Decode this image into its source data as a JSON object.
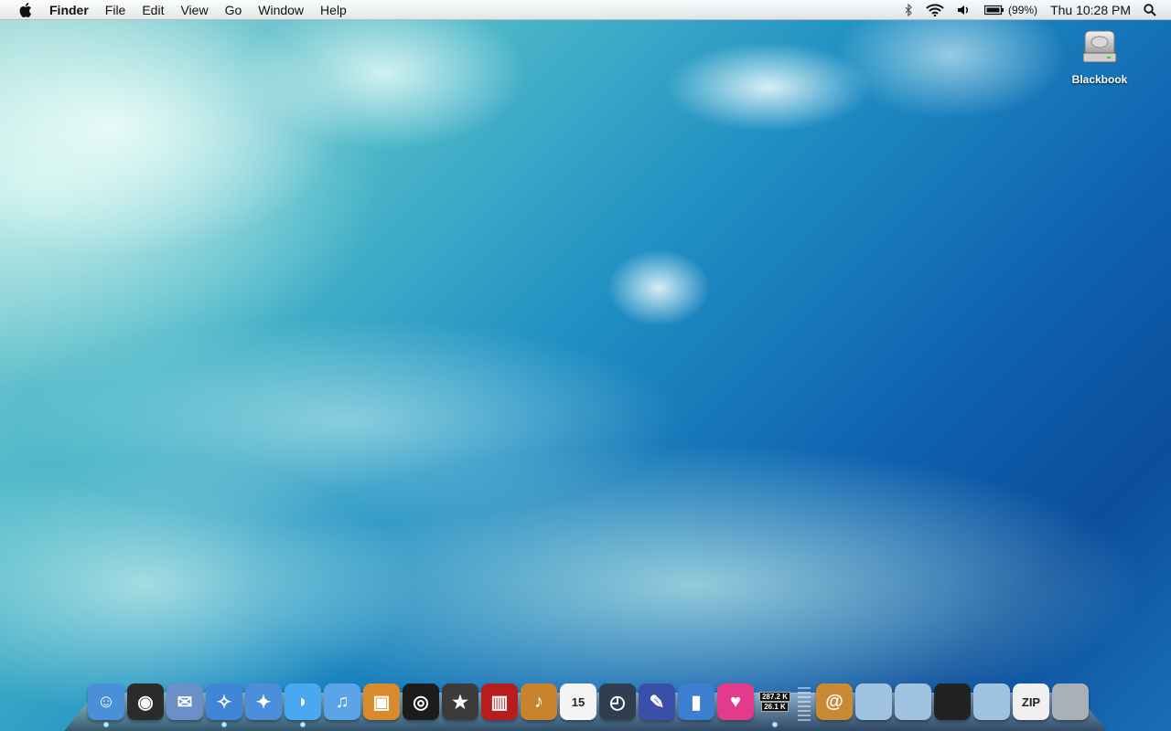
{
  "menubar": {
    "app_name": "Finder",
    "items": [
      "File",
      "Edit",
      "View",
      "Go",
      "Window",
      "Help"
    ],
    "status": {
      "battery_percent": "(99%)",
      "clock": "Thu 10:28 PM",
      "icons": [
        "bluetooth-icon",
        "wifi-icon",
        "volume-icon",
        "battery-icon",
        "spotlight-icon"
      ]
    }
  },
  "desktop": {
    "disk_label": "Blackbook"
  },
  "dock": {
    "apps": [
      {
        "name": "finder",
        "glyph": "☺",
        "color": "#4a90d9",
        "running": true
      },
      {
        "name": "dashboard",
        "glyph": "◉",
        "color": "#2b2b2b",
        "running": false
      },
      {
        "name": "mail",
        "glyph": "✉",
        "color": "#6a8fc9",
        "running": false
      },
      {
        "name": "safari",
        "glyph": "✧",
        "color": "#3f87d6",
        "running": true
      },
      {
        "name": "network",
        "glyph": "✦",
        "color": "#4c8ed9",
        "running": false
      },
      {
        "name": "ichat",
        "glyph": "◗",
        "color": "#4aa8f0",
        "running": true
      },
      {
        "name": "itunes",
        "glyph": "♫",
        "color": "#5aa4e8",
        "running": false
      },
      {
        "name": "iphoto",
        "glyph": "▣",
        "color": "#d88a2c",
        "running": false
      },
      {
        "name": "photo-booth",
        "glyph": "◎",
        "color": "#1c1c1c",
        "running": false
      },
      {
        "name": "imovie",
        "glyph": "★",
        "color": "#3b3b3b",
        "running": false
      },
      {
        "name": "front-row",
        "glyph": "▥",
        "color": "#b81d1d",
        "running": false
      },
      {
        "name": "garageband",
        "glyph": "♪",
        "color": "#c9822e",
        "running": false
      },
      {
        "name": "ical",
        "glyph": "15",
        "color": "#f4f4f4",
        "running": false
      },
      {
        "name": "time-machine",
        "glyph": "◴",
        "color": "#2f3f4f",
        "running": false
      },
      {
        "name": "iweb",
        "glyph": "✎",
        "color": "#3a4fa8",
        "running": false
      },
      {
        "name": "numbers",
        "glyph": "▮",
        "color": "#3c7fd1",
        "running": false
      },
      {
        "name": "heart-app",
        "glyph": "♥",
        "color": "#e23b8b",
        "running": false
      },
      {
        "name": "network-monitor",
        "glyph": "",
        "color": "#3b3b3b",
        "running": true
      }
    ],
    "network_monitor": {
      "upload": "287.2 K",
      "download": "26.1 K"
    },
    "stacks": [
      {
        "name": "address-book",
        "glyph": "@",
        "color": "#c98a35"
      },
      {
        "name": "folder-1",
        "glyph": "",
        "color": "#9fc3e0"
      },
      {
        "name": "folder-2",
        "glyph": "",
        "color": "#9fc3e0"
      },
      {
        "name": "folder-3",
        "glyph": "",
        "color": "#222222"
      },
      {
        "name": "folder-4",
        "glyph": "",
        "color": "#9fc3e0"
      },
      {
        "name": "zip-archive",
        "glyph": "ZIP",
        "color": "#f0f0f0"
      },
      {
        "name": "trash",
        "glyph": "",
        "color": "#a9b0b6"
      }
    ]
  }
}
